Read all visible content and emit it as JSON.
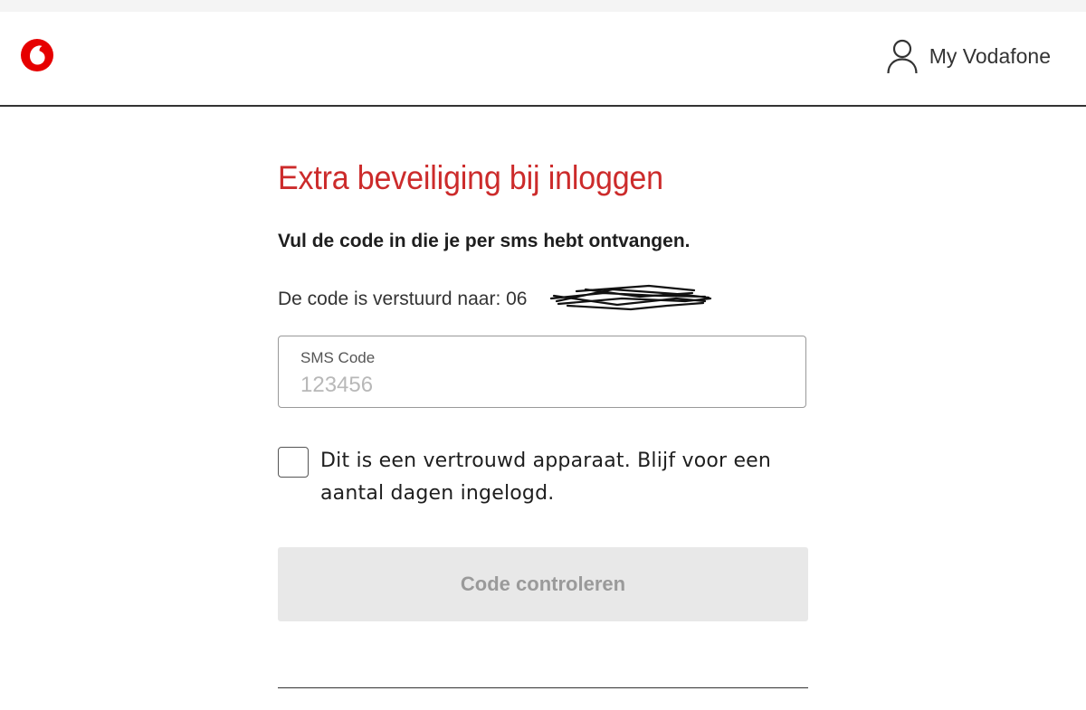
{
  "header": {
    "logo_icon": "vodafone-logo-icon",
    "account_icon": "user-icon",
    "account_label": "My Vodafone",
    "brand_color": "#e60000"
  },
  "main": {
    "title": "Extra beveiliging bij inloggen",
    "subtitle": "Vul de code in die je per sms hebt ontvangen.",
    "sent_text": "De code is verstuurd naar: 06",
    "field_label": "SMS Code",
    "field_value": "",
    "field_placeholder": "123456",
    "checkbox_checked": false,
    "checkbox_label": "Dit is een vertrouwd apparaat. Blijf voor een aantal dagen ingelogd.",
    "button_label": "Code controleren",
    "button_disabled": true,
    "title_color": "#cc2b2b"
  }
}
